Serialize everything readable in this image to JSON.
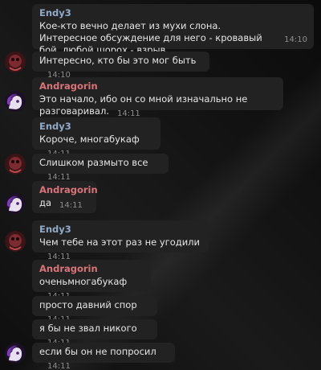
{
  "senders": {
    "endy3": "Endy3",
    "andragorin": "Andragorin"
  },
  "messages": [
    {
      "sender": "Endy3",
      "text": "Кое-кто вечно делает из мухи слона. Интересное обсуждение для него - кровавый бой, любой шорох - взрыв.",
      "time": "14:10"
    },
    {
      "text": "Интересно, кто бы это мог быть",
      "time": "14:10"
    },
    {
      "sender": "Andragorin",
      "text": "Это начало, ибо он со мной изначально не разговаривал.",
      "time": "14:11"
    },
    {
      "sender": "Endy3",
      "text": "Короче, многабукаф",
      "time": "14:11"
    },
    {
      "text": "Слишком размыто все",
      "time": "14:11"
    },
    {
      "sender": "Andragorin",
      "text": "да",
      "time": "14:11"
    },
    {
      "sender": "Endy3",
      "text": "Чем тебе на этот раз не угодили",
      "time": "14:11"
    },
    {
      "sender": "Andragorin",
      "text": "оченьмногабукаф",
      "time": "14:11"
    },
    {
      "text": "просто давний спор",
      "time": "14:11"
    },
    {
      "text": "я бы не звал никого",
      "time": "14:11"
    },
    {
      "text": "если бы он не попросил",
      "time": "14:11"
    }
  ],
  "avatars": {
    "endy3": "dark-red-avatar",
    "andragorin": "purple-pony-avatar"
  },
  "colors": {
    "bubble": "#222222",
    "endy3_name": "#92a9c9",
    "andragorin_name": "#d8747a",
    "time": "#8e8e8e"
  }
}
